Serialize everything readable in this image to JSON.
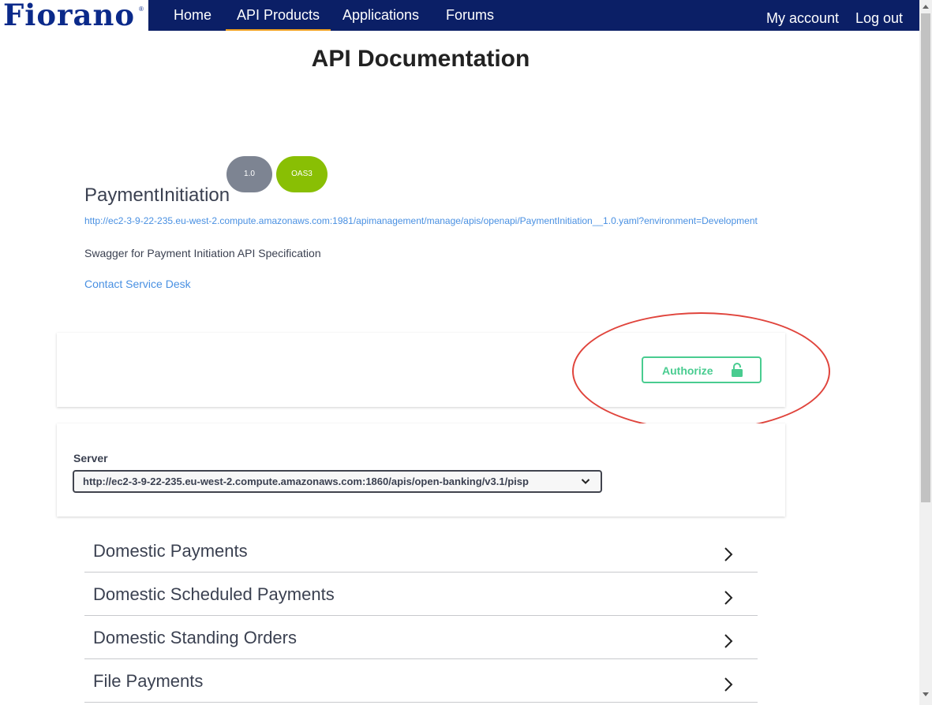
{
  "header": {
    "logo_text": "Fiorano",
    "logo_mark": "®",
    "nav": [
      {
        "label": "Home"
      },
      {
        "label": "API Products"
      },
      {
        "label": "Applications"
      },
      {
        "label": "Forums"
      }
    ],
    "active_nav": "API Products",
    "my_account": "My account",
    "log_out": "Log out",
    "colors": {
      "bar": "#0b1f66",
      "active_underline": "#f0a020"
    }
  },
  "page": {
    "title": "API Documentation"
  },
  "api_info": {
    "title": "PaymentInitiation",
    "version_badge": "1.0",
    "spec_badge": "OAS3",
    "spec_url": "http://ec2-3-9-22-235.eu-west-2.compute.amazonaws.com:1981/apimanagement/manage/apis/openapi/PaymentInitiation__1.0.yaml?environment=Development",
    "description": "Swagger for Payment Initiation API Specification",
    "contact_link": "Contact Service Desk",
    "colors": {
      "version_badge": "#7d8492",
      "spec_badge": "#89bf04",
      "link": "#4990e2"
    }
  },
  "authorize": {
    "label": "Authorize",
    "icon": "unlocked-padlock-icon",
    "color": "#49cc90",
    "annotation_color": "#e0443c"
  },
  "servers": {
    "label": "Server",
    "selected": "http://ec2-3-9-22-235.eu-west-2.compute.amazonaws.com:1860/apis/open-banking/v3.1/pisp"
  },
  "tags": [
    {
      "name": "Domestic Payments"
    },
    {
      "name": "Domestic Scheduled Payments"
    },
    {
      "name": "Domestic Standing Orders"
    },
    {
      "name": "File Payments"
    }
  ]
}
